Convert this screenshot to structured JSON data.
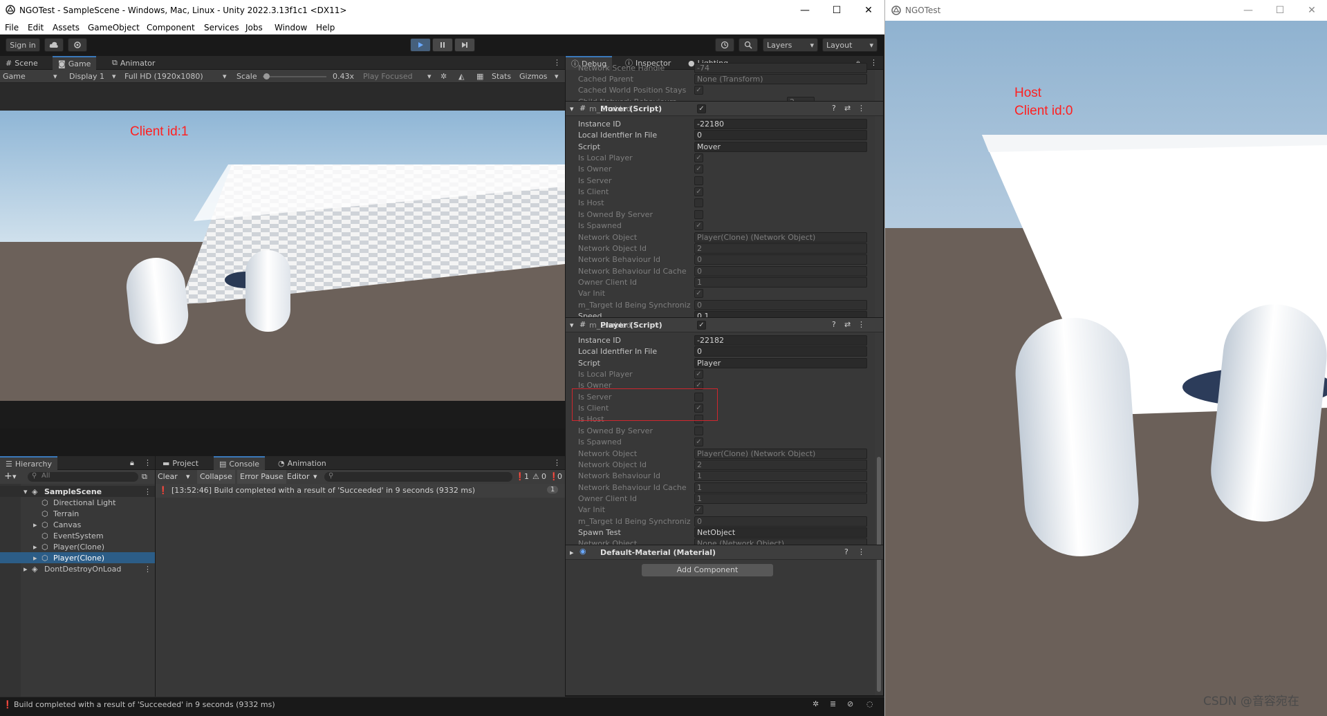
{
  "unity": {
    "title": "NGOTest - SampleScene - Windows, Mac, Linux - Unity 2022.3.13f1c1 <DX11>",
    "menu": [
      "File",
      "Edit",
      "Assets",
      "GameObject",
      "Component",
      "Services",
      "Jobs",
      "Window",
      "Help"
    ],
    "toolbar": {
      "sign_in": "Sign in",
      "layers": "Layers",
      "layout": "Layout"
    },
    "tabs": {
      "scene": "Scene",
      "game": "Game",
      "animator": "Animator"
    },
    "game_bar": {
      "mode": "Game",
      "display": "Display 1",
      "resolution": "Full HD (1920x1080)",
      "scale_label": "Scale",
      "scale_value": "0.43x",
      "play_focused": "Play Focused",
      "stats": "Stats",
      "gizmos": "Gizmos"
    },
    "game_overlay": "Client id:1",
    "hierarchy": {
      "tab": "Hierarchy",
      "search_placeholder": "All",
      "items": [
        {
          "label": "SampleScene"
        },
        {
          "label": "Directional Light"
        },
        {
          "label": "Terrain"
        },
        {
          "label": "Canvas"
        },
        {
          "label": "EventSystem"
        },
        {
          "label": "Player(Clone)"
        },
        {
          "label": "Player(Clone)"
        },
        {
          "label": "DontDestroyOnLoad"
        }
      ]
    },
    "console": {
      "tabs": [
        "Project",
        "Console",
        "Animation"
      ],
      "buttons": {
        "clear": "Clear",
        "collapse": "Collapse",
        "error_pause": "Error Pause",
        "editor": "Editor"
      },
      "counts": {
        "log": "1",
        "warn": "0",
        "error": "0"
      },
      "entry": "[13:52:46] Build completed with a result of 'Succeeded' in 9 seconds (9332 ms)",
      "entry_count": "1"
    },
    "status": "Build completed with a result of 'Succeeded' in 9 seconds (9332 ms)",
    "inspector": {
      "tabs": [
        "Debug",
        "Inspector",
        "Lighting"
      ],
      "top_rows": [
        {
          "label": "Network Scene Handle",
          "value": "-74"
        },
        {
          "label": "Cached Parent",
          "value": "None (Transform)"
        },
        {
          "label": "Cached World Position Stays",
          "value": "✓"
        },
        {
          "label": "Child Network Behaviours",
          "value": "2"
        }
      ],
      "mover": {
        "header": "m_Enabled",
        "header_overlay": "Mover (Script)",
        "header_check": "✓",
        "rows": [
          {
            "label": "Instance ID",
            "value": "-22180"
          },
          {
            "label": "Local Identfier In File",
            "value": "0"
          },
          {
            "label": "Script",
            "value": "Mover"
          },
          {
            "label": "Is Local Player",
            "value": "✓"
          },
          {
            "label": "Is Owner",
            "value": "✓"
          },
          {
            "label": "Is Server",
            "value": ""
          },
          {
            "label": "Is Client",
            "value": "✓"
          },
          {
            "label": "Is Host",
            "value": ""
          },
          {
            "label": "Is Owned By Server",
            "value": ""
          },
          {
            "label": "Is Spawned",
            "value": "✓"
          },
          {
            "label": "Network Object",
            "value": "Player(Clone) (Network Object)"
          },
          {
            "label": "Network Object Id",
            "value": "2"
          },
          {
            "label": "Network Behaviour Id",
            "value": "0"
          },
          {
            "label": "Network Behaviour Id Cache",
            "value": "0"
          },
          {
            "label": "Owner Client Id",
            "value": "1"
          },
          {
            "label": "Var Init",
            "value": "✓"
          },
          {
            "label": "m_Target Id Being Synchroniz",
            "value": "0"
          },
          {
            "label": "Speed",
            "value": "0.1"
          }
        ]
      },
      "player": {
        "header": "m_Enabled",
        "header_overlay": "Player (Script)",
        "header_check": "✓",
        "rows": [
          {
            "label": "Instance ID",
            "value": "-22182"
          },
          {
            "label": "Local Identfier In File",
            "value": "0"
          },
          {
            "label": "Script",
            "value": "Player"
          },
          {
            "label": "Is Local Player",
            "value": "✓"
          },
          {
            "label": "Is Owner",
            "value": "✓"
          },
          {
            "label": "Is Server",
            "value": ""
          },
          {
            "label": "Is Client",
            "value": "✓"
          },
          {
            "label": "Is Host",
            "value": ""
          },
          {
            "label": "Is Owned By Server",
            "value": ""
          },
          {
            "label": "Is Spawned",
            "value": "✓"
          },
          {
            "label": "Network Object",
            "value": "Player(Clone) (Network Object)"
          },
          {
            "label": "Network Object Id",
            "value": "2"
          },
          {
            "label": "Network Behaviour Id",
            "value": "1"
          },
          {
            "label": "Network Behaviour Id Cache",
            "value": "1"
          },
          {
            "label": "Owner Client Id",
            "value": "1"
          },
          {
            "label": "Var Init",
            "value": "✓"
          },
          {
            "label": "m_Target Id Being Synchroniz",
            "value": "0"
          },
          {
            "label": "Spawn Test",
            "value": "NetObject"
          },
          {
            "label": "Network Object",
            "value": "None (Network Object)"
          }
        ]
      },
      "material": "Default-Material (Material)",
      "add_component": "Add Component"
    }
  },
  "ngo": {
    "title": "NGOTest",
    "overlay_host": "Host",
    "overlay_client": "Client id:0",
    "watermark": "CSDN @音容宛在"
  },
  "colors": {
    "accent": "#3a79bb",
    "highlight_box": "#d0262e",
    "overlay_text": "#ff2020"
  }
}
